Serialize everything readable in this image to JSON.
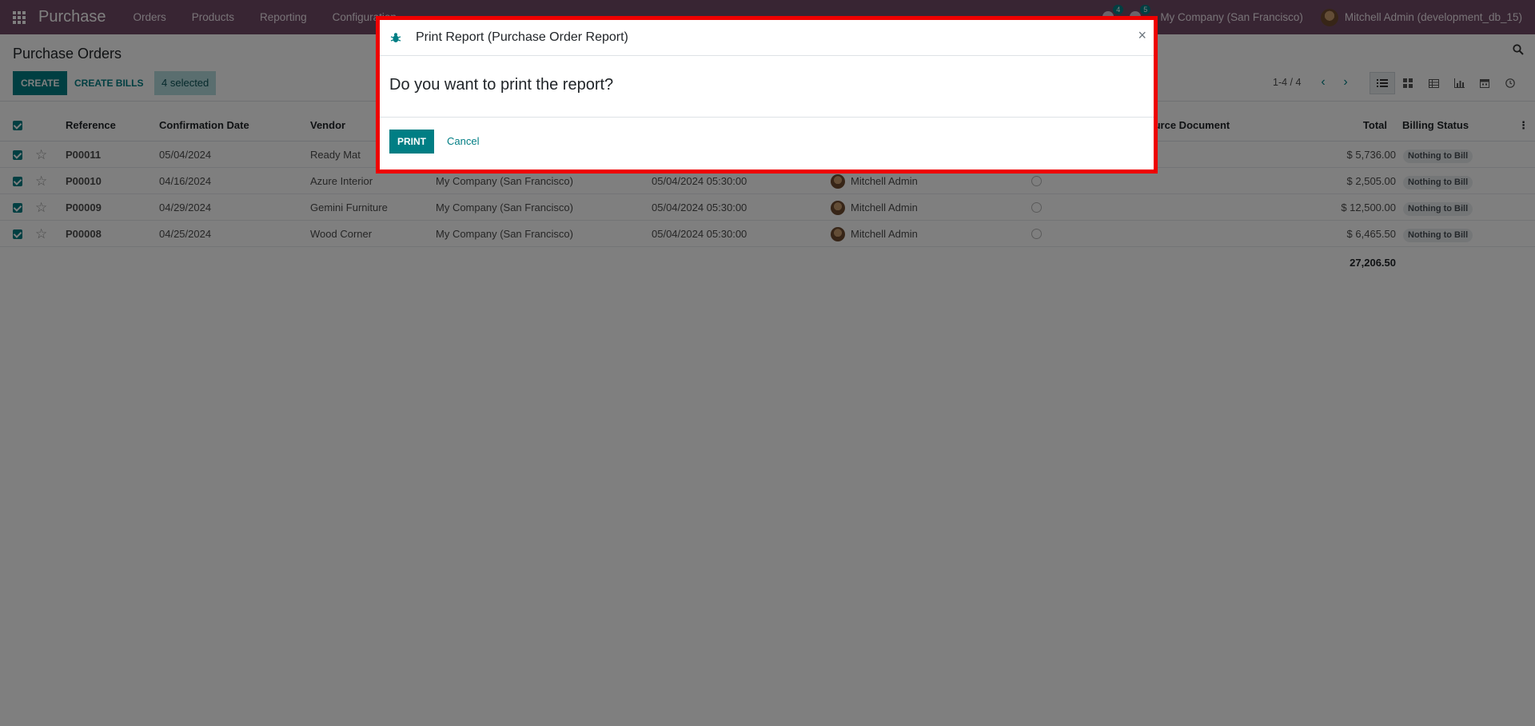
{
  "navbar": {
    "app_name": "Purchase",
    "menu": [
      "Orders",
      "Products",
      "Reporting",
      "Configuration"
    ],
    "messages_count": "4",
    "activities_count": "5",
    "company": "My Company (San Francisco)",
    "user": "Mitchell Admin (development_db_15)"
  },
  "control_panel": {
    "title": "Purchase Orders",
    "create_label": "CREATE",
    "create_bills_label": "CREATE BILLS",
    "selected_label": "4 selected",
    "pager": "1-4 / 4",
    "views": [
      "list-view-icon",
      "kanban-view-icon",
      "pivot-view-icon",
      "graph-view-icon",
      "calendar-view-icon",
      "activity-view-icon"
    ]
  },
  "table": {
    "headers": {
      "reference": "Reference",
      "confirmation_date": "Confirmation Date",
      "vendor": "Vendor",
      "source_document": "Source Document",
      "total": "Total",
      "billing_status": "Billing Status"
    },
    "rows": [
      {
        "ref": "P00011",
        "date": "05/04/2024",
        "vendor": "Ready Mat",
        "company": "",
        "receipt": "",
        "buyer": "",
        "total": "$ 5,736.00",
        "status": "Nothing to Bill"
      },
      {
        "ref": "P00010",
        "date": "04/16/2024",
        "vendor": "Azure Interior",
        "company": "My Company (San Francisco)",
        "receipt": "05/04/2024 05:30:00",
        "buyer": "Mitchell Admin",
        "total": "$ 2,505.00",
        "status": "Nothing to Bill"
      },
      {
        "ref": "P00009",
        "date": "04/29/2024",
        "vendor": "Gemini Furniture",
        "company": "My Company (San Francisco)",
        "receipt": "05/04/2024 05:30:00",
        "buyer": "Mitchell Admin",
        "total": "$ 12,500.00",
        "status": "Nothing to Bill"
      },
      {
        "ref": "P00008",
        "date": "04/25/2024",
        "vendor": "Wood Corner",
        "company": "My Company (San Francisco)",
        "receipt": "05/04/2024 05:30:00",
        "buyer": "Mitchell Admin",
        "total": "$ 6,465.50",
        "status": "Nothing to Bill"
      }
    ],
    "grand_total": "27,206.50"
  },
  "dialog": {
    "title": "Print Report (Purchase Order Report)",
    "question": "Do you want to print the report?",
    "print_label": "PRINT",
    "cancel_label": "Cancel",
    "close_symbol": "×"
  },
  "colors": {
    "navbar": "#714b67",
    "primary": "#017e84",
    "highlight_border": "#ee0000"
  }
}
